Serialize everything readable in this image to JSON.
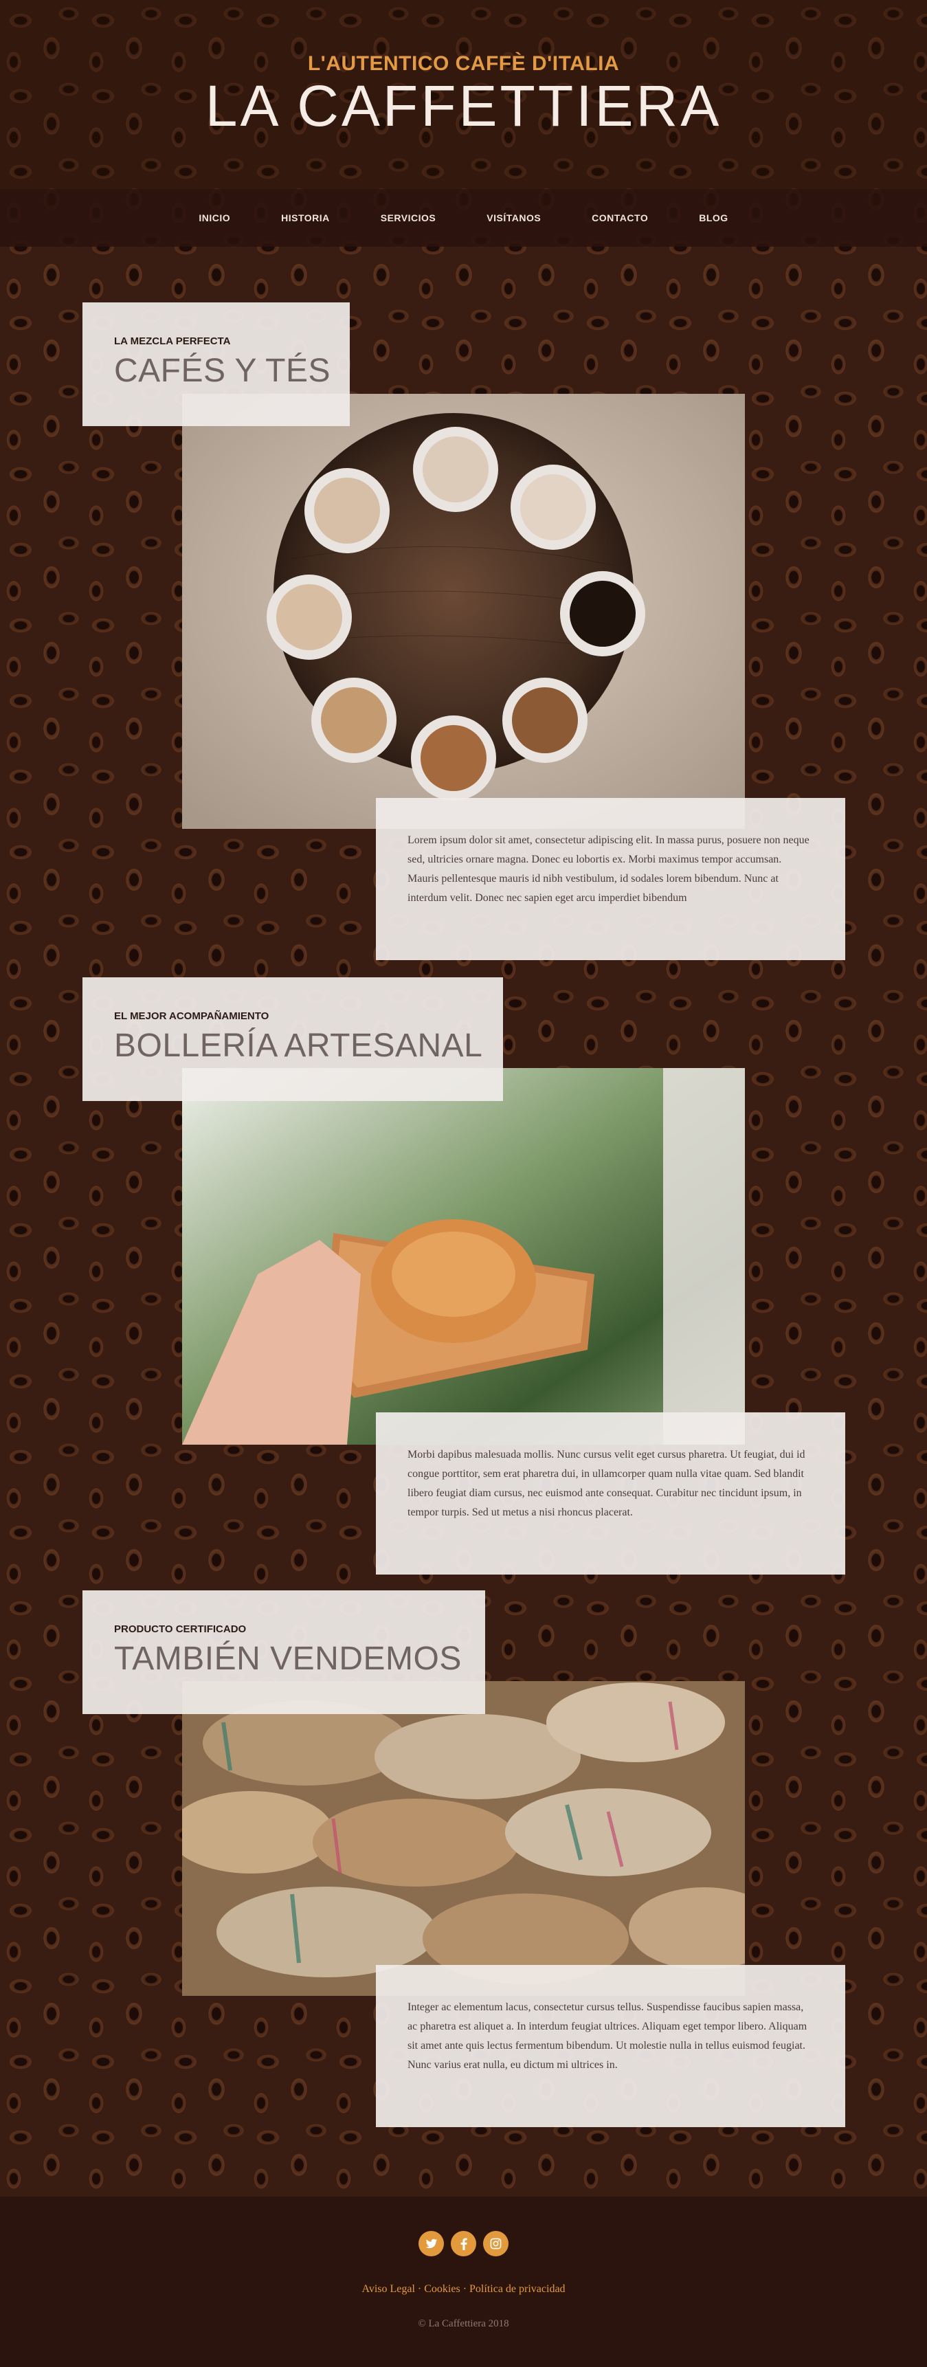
{
  "header": {
    "tagline": "L'AUTENTICO CAFFÈ D'ITALIA",
    "brand": "LA CAFFETTIERA"
  },
  "nav": {
    "items": [
      {
        "label": "INICIO"
      },
      {
        "label": "HISTORIA"
      },
      {
        "label": "SERVICIOS"
      },
      {
        "label": "VISÍTANOS"
      },
      {
        "label": "CONTACTO"
      },
      {
        "label": "BLOG"
      }
    ]
  },
  "sections": [
    {
      "kicker": "LA MEZCLA PERFECTA",
      "heading": "CAFÉS Y TÉS",
      "text": "Lorem ipsum dolor sit amet, consectetur adipiscing elit. In massa purus, posuere non neque sed, ultricies ornare magna. Donec eu lobortis ex. Morbi maximus tempor accumsan. Mauris pellentesque mauris id nibh vestibulum, id sodales lorem bibendum. Nunc at interdum velit. Donec nec sapien eget arcu imperdiet bibendum"
    },
    {
      "kicker": "EL MEJOR ACOMPAÑAMIENTO",
      "heading": "BOLLERÍA ARTESANAL",
      "text": "Morbi dapibus malesuada mollis. Nunc cursus velit eget cursus pharetra. Ut feugiat, dui id congue porttitor, sem erat pharetra dui, in ullamcorper quam nulla vitae quam. Sed blandit libero feugiat diam cursus, nec euismod ante consequat. Curabitur nec tincidunt ipsum, in tempor turpis. Sed ut metus a nisi rhoncus placerat."
    },
    {
      "kicker": "PRODUCTO CERTIFICADO",
      "heading": "TAMBIÉN VENDEMOS",
      "text": "Integer ac elementum lacus, consectetur cursus tellus. Suspendisse faucibus sapien massa, ac pharetra est aliquet a. In interdum feugiat ultrices. Aliquam eget tempor libero. Aliquam sit amet ante quis lectus fermentum bibendum. Ut molestie nulla in tellus euismod feugiat. Nunc varius erat nulla, eu dictum mi ultrices in."
    }
  ],
  "footer": {
    "social": [
      "twitter-icon",
      "facebook-icon",
      "instagram-icon"
    ],
    "links": [
      {
        "label": "Aviso Legal"
      },
      {
        "label": "Cookies"
      },
      {
        "label": "Política de privacidad"
      }
    ],
    "separator": "·",
    "copyright": "© La Caffettiera 2018"
  },
  "colors": {
    "accent": "#e29a3d",
    "nav_bg": "#2a120c",
    "card_bg": "#f0ece9"
  }
}
